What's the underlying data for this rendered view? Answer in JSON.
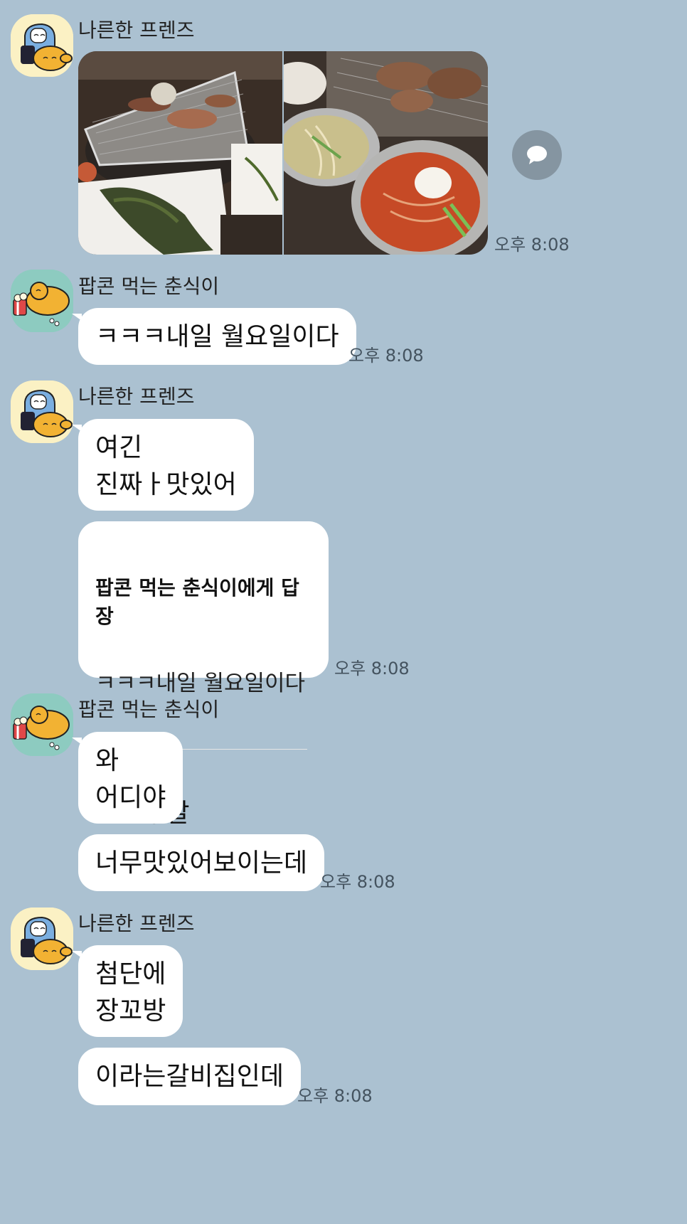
{
  "users": {
    "a": {
      "name": "나른한 프렌즈",
      "avatar_icon": "sleepy-friends-avatar-icon"
    },
    "b": {
      "name": "팝콘 먹는 춘식이",
      "avatar_icon": "popcorn-choonsik-avatar-icon"
    }
  },
  "messages": {
    "m1": {
      "sender": "나른한 프렌즈",
      "type": "photos",
      "photo_count": 2,
      "time": "오후 8:08"
    },
    "m2": {
      "sender": "팝콘 먹는 춘식이",
      "text": "ㅋㅋㅋ내일 월요일이다",
      "time": "오후 8:08"
    },
    "m3": {
      "sender": "나른한 프렌즈",
      "text1": "여긴\n진짜ㅏ맛있어"
    },
    "m4": {
      "reply_to_title": "팝콘 먹는 춘식이에게 답장",
      "reply_quote": "ㅋㅋㅋ내일 월요일이다",
      "text": "스친주말",
      "time": "오후 8:08"
    },
    "m5": {
      "sender": "팝콘 먹는 춘식이",
      "text1": "와\n어디야",
      "text2": "너무맛있어보이는데",
      "time": "오후 8:08"
    },
    "m6": {
      "sender": "나른한 프렌즈",
      "text1": "첨단에\n장꼬방",
      "text2": "이라는갈비집인데",
      "time": "오후 8:08"
    }
  },
  "colors": {
    "background": "#abc1d1",
    "bubble": "#ffffff",
    "share_button": "#8595a1"
  }
}
